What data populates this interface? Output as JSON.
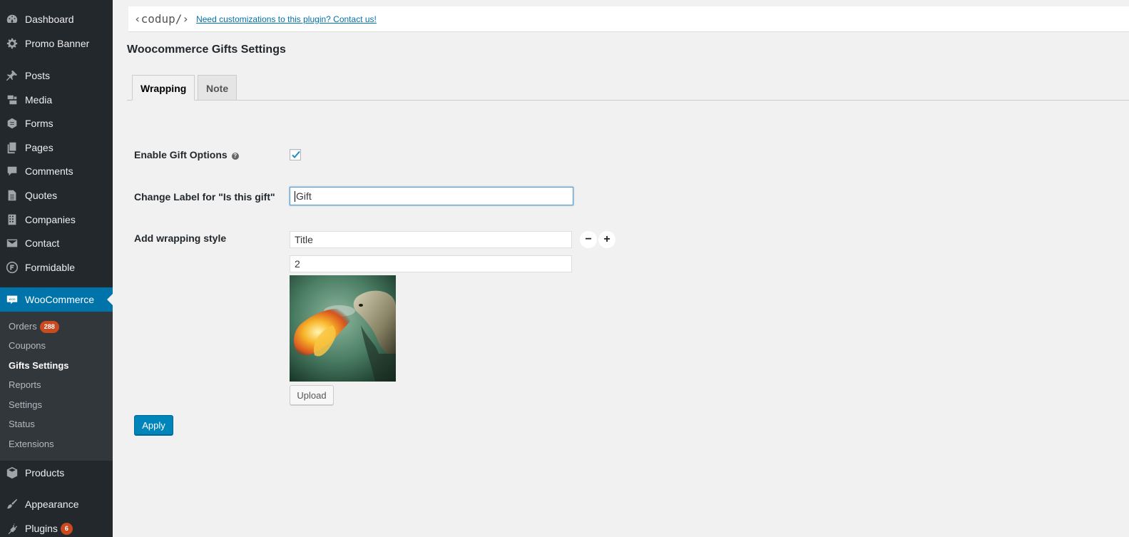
{
  "sidebar": {
    "items": [
      {
        "label": "Dashboard",
        "icon": "dashboard-icon"
      },
      {
        "label": "Promo Banner",
        "icon": "gear-icon"
      },
      {
        "label": "Posts",
        "icon": "pin-icon"
      },
      {
        "label": "Media",
        "icon": "media-icon"
      },
      {
        "label": "Forms",
        "icon": "forms-icon"
      },
      {
        "label": "Pages",
        "icon": "pages-icon"
      },
      {
        "label": "Comments",
        "icon": "comment-icon"
      },
      {
        "label": "Quotes",
        "icon": "document-icon"
      },
      {
        "label": "Companies",
        "icon": "building-icon"
      },
      {
        "label": "Contact",
        "icon": "envelope-icon"
      },
      {
        "label": "Formidable",
        "icon": "formidable-icon"
      },
      {
        "label": "WooCommerce",
        "icon": "woo-icon"
      },
      {
        "label": "Products",
        "icon": "box-icon"
      },
      {
        "label": "Appearance",
        "icon": "brush-icon"
      },
      {
        "label": "Plugins",
        "icon": "plugin-icon",
        "badge": "6"
      }
    ],
    "submenu": [
      {
        "label": "Orders",
        "badge": "288"
      },
      {
        "label": "Coupons"
      },
      {
        "label": "Gifts Settings"
      },
      {
        "label": "Reports"
      },
      {
        "label": "Settings"
      },
      {
        "label": "Status"
      },
      {
        "label": "Extensions"
      }
    ],
    "colors": {
      "bg": "#23282d",
      "active": "#0073aa",
      "badge": "#ca4a1f"
    }
  },
  "banner": {
    "logo": "‹codup/›",
    "contact_link": "Need customizations to this plugin? Contact us!"
  },
  "page": {
    "title": "Woocommerce Gifts Settings"
  },
  "tabs": [
    {
      "label": "Wrapping",
      "active": true
    },
    {
      "label": "Note",
      "active": false
    }
  ],
  "form": {
    "enable_label": "Enable Gift Options",
    "help_glyph": "?",
    "enable_checked": true,
    "change_label_label": "Change Label for \"Is this gift\"",
    "change_label_value": "Gift",
    "wrapping_label": "Add wrapping style",
    "wrapping_title_value": "Title",
    "wrapping_price_value": "2",
    "minus_glyph": "−",
    "plus_glyph": "+",
    "upload_label": "Upload",
    "apply_label": "Apply"
  }
}
